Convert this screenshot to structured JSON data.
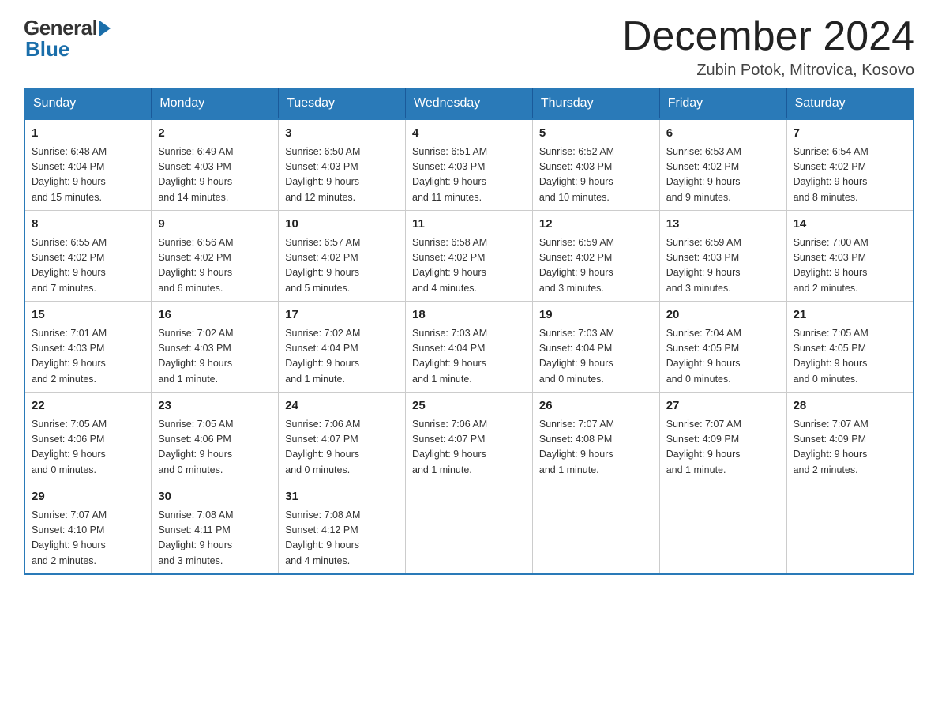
{
  "header": {
    "logo_general": "General",
    "logo_blue": "Blue",
    "title": "December 2024",
    "location": "Zubin Potok, Mitrovica, Kosovo"
  },
  "days_of_week": [
    "Sunday",
    "Monday",
    "Tuesday",
    "Wednesday",
    "Thursday",
    "Friday",
    "Saturday"
  ],
  "weeks": [
    [
      {
        "day": "1",
        "info": "Sunrise: 6:48 AM\nSunset: 4:04 PM\nDaylight: 9 hours\nand 15 minutes."
      },
      {
        "day": "2",
        "info": "Sunrise: 6:49 AM\nSunset: 4:03 PM\nDaylight: 9 hours\nand 14 minutes."
      },
      {
        "day": "3",
        "info": "Sunrise: 6:50 AM\nSunset: 4:03 PM\nDaylight: 9 hours\nand 12 minutes."
      },
      {
        "day": "4",
        "info": "Sunrise: 6:51 AM\nSunset: 4:03 PM\nDaylight: 9 hours\nand 11 minutes."
      },
      {
        "day": "5",
        "info": "Sunrise: 6:52 AM\nSunset: 4:03 PM\nDaylight: 9 hours\nand 10 minutes."
      },
      {
        "day": "6",
        "info": "Sunrise: 6:53 AM\nSunset: 4:02 PM\nDaylight: 9 hours\nand 9 minutes."
      },
      {
        "day": "7",
        "info": "Sunrise: 6:54 AM\nSunset: 4:02 PM\nDaylight: 9 hours\nand 8 minutes."
      }
    ],
    [
      {
        "day": "8",
        "info": "Sunrise: 6:55 AM\nSunset: 4:02 PM\nDaylight: 9 hours\nand 7 minutes."
      },
      {
        "day": "9",
        "info": "Sunrise: 6:56 AM\nSunset: 4:02 PM\nDaylight: 9 hours\nand 6 minutes."
      },
      {
        "day": "10",
        "info": "Sunrise: 6:57 AM\nSunset: 4:02 PM\nDaylight: 9 hours\nand 5 minutes."
      },
      {
        "day": "11",
        "info": "Sunrise: 6:58 AM\nSunset: 4:02 PM\nDaylight: 9 hours\nand 4 minutes."
      },
      {
        "day": "12",
        "info": "Sunrise: 6:59 AM\nSunset: 4:02 PM\nDaylight: 9 hours\nand 3 minutes."
      },
      {
        "day": "13",
        "info": "Sunrise: 6:59 AM\nSunset: 4:03 PM\nDaylight: 9 hours\nand 3 minutes."
      },
      {
        "day": "14",
        "info": "Sunrise: 7:00 AM\nSunset: 4:03 PM\nDaylight: 9 hours\nand 2 minutes."
      }
    ],
    [
      {
        "day": "15",
        "info": "Sunrise: 7:01 AM\nSunset: 4:03 PM\nDaylight: 9 hours\nand 2 minutes."
      },
      {
        "day": "16",
        "info": "Sunrise: 7:02 AM\nSunset: 4:03 PM\nDaylight: 9 hours\nand 1 minute."
      },
      {
        "day": "17",
        "info": "Sunrise: 7:02 AM\nSunset: 4:04 PM\nDaylight: 9 hours\nand 1 minute."
      },
      {
        "day": "18",
        "info": "Sunrise: 7:03 AM\nSunset: 4:04 PM\nDaylight: 9 hours\nand 1 minute."
      },
      {
        "day": "19",
        "info": "Sunrise: 7:03 AM\nSunset: 4:04 PM\nDaylight: 9 hours\nand 0 minutes."
      },
      {
        "day": "20",
        "info": "Sunrise: 7:04 AM\nSunset: 4:05 PM\nDaylight: 9 hours\nand 0 minutes."
      },
      {
        "day": "21",
        "info": "Sunrise: 7:05 AM\nSunset: 4:05 PM\nDaylight: 9 hours\nand 0 minutes."
      }
    ],
    [
      {
        "day": "22",
        "info": "Sunrise: 7:05 AM\nSunset: 4:06 PM\nDaylight: 9 hours\nand 0 minutes."
      },
      {
        "day": "23",
        "info": "Sunrise: 7:05 AM\nSunset: 4:06 PM\nDaylight: 9 hours\nand 0 minutes."
      },
      {
        "day": "24",
        "info": "Sunrise: 7:06 AM\nSunset: 4:07 PM\nDaylight: 9 hours\nand 0 minutes."
      },
      {
        "day": "25",
        "info": "Sunrise: 7:06 AM\nSunset: 4:07 PM\nDaylight: 9 hours\nand 1 minute."
      },
      {
        "day": "26",
        "info": "Sunrise: 7:07 AM\nSunset: 4:08 PM\nDaylight: 9 hours\nand 1 minute."
      },
      {
        "day": "27",
        "info": "Sunrise: 7:07 AM\nSunset: 4:09 PM\nDaylight: 9 hours\nand 1 minute."
      },
      {
        "day": "28",
        "info": "Sunrise: 7:07 AM\nSunset: 4:09 PM\nDaylight: 9 hours\nand 2 minutes."
      }
    ],
    [
      {
        "day": "29",
        "info": "Sunrise: 7:07 AM\nSunset: 4:10 PM\nDaylight: 9 hours\nand 2 minutes."
      },
      {
        "day": "30",
        "info": "Sunrise: 7:08 AM\nSunset: 4:11 PM\nDaylight: 9 hours\nand 3 minutes."
      },
      {
        "day": "31",
        "info": "Sunrise: 7:08 AM\nSunset: 4:12 PM\nDaylight: 9 hours\nand 4 minutes."
      },
      null,
      null,
      null,
      null
    ]
  ]
}
